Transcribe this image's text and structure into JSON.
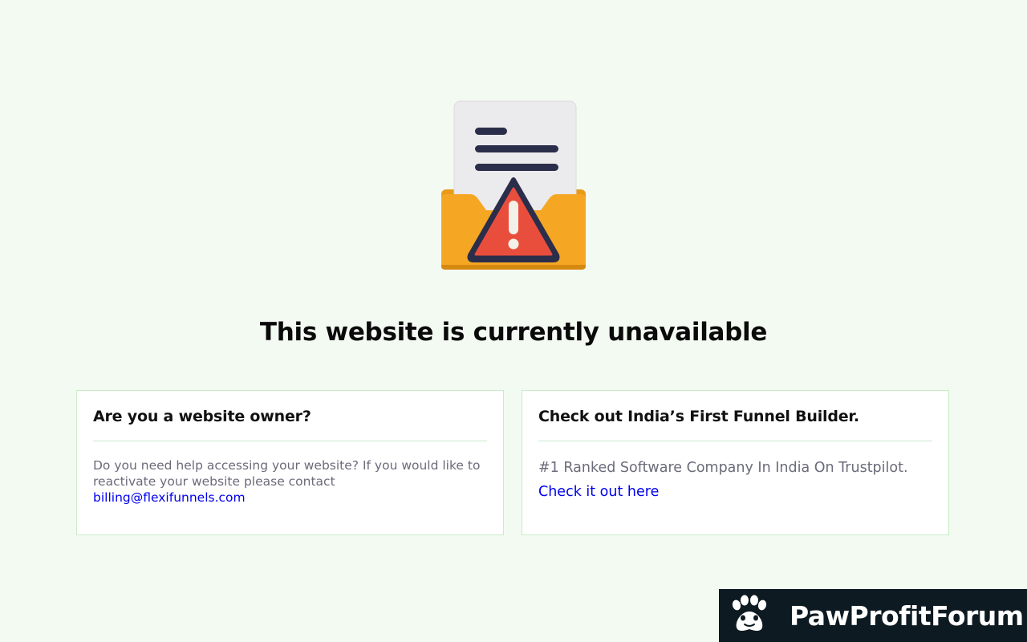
{
  "page": {
    "title": "This website is currently unavailable"
  },
  "owner_card": {
    "title": "Are you a website owner?",
    "body": "Do you need help accessing your website? If you would like to reactivate your website please contact",
    "email_link": "billing@flexifunnels.com"
  },
  "promo_card": {
    "title": "Check out India’s First Funnel Builder.",
    "body": "#1 Ranked Software Company In India On Trustpilot.",
    "link": "Check it out here"
  },
  "badge": {
    "text": "PawProfitForum",
    "icon": "paw-icon"
  },
  "colors": {
    "background": "#f3faf2",
    "card_border": "#c8ecc6",
    "link": "#0000ee",
    "badge_bg": "#0e1a22",
    "folder": "#f5a623",
    "warning": "#e94e3c"
  },
  "hero": {
    "icon": "document-warning-folder-icon"
  }
}
